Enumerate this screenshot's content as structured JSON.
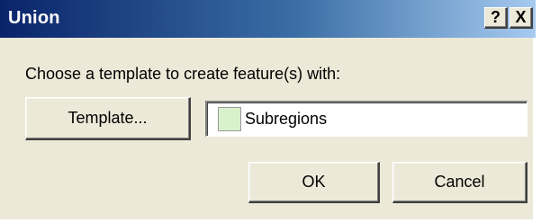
{
  "window": {
    "title": "Union",
    "help_label": "?",
    "close_label": "X"
  },
  "prompt": "Choose a template to create feature(s) with:",
  "template_button": "Template...",
  "template_field": {
    "value": "Subregions",
    "swatch_color": "#d9f2cd"
  },
  "buttons": {
    "ok": "OK",
    "cancel": "Cancel"
  }
}
